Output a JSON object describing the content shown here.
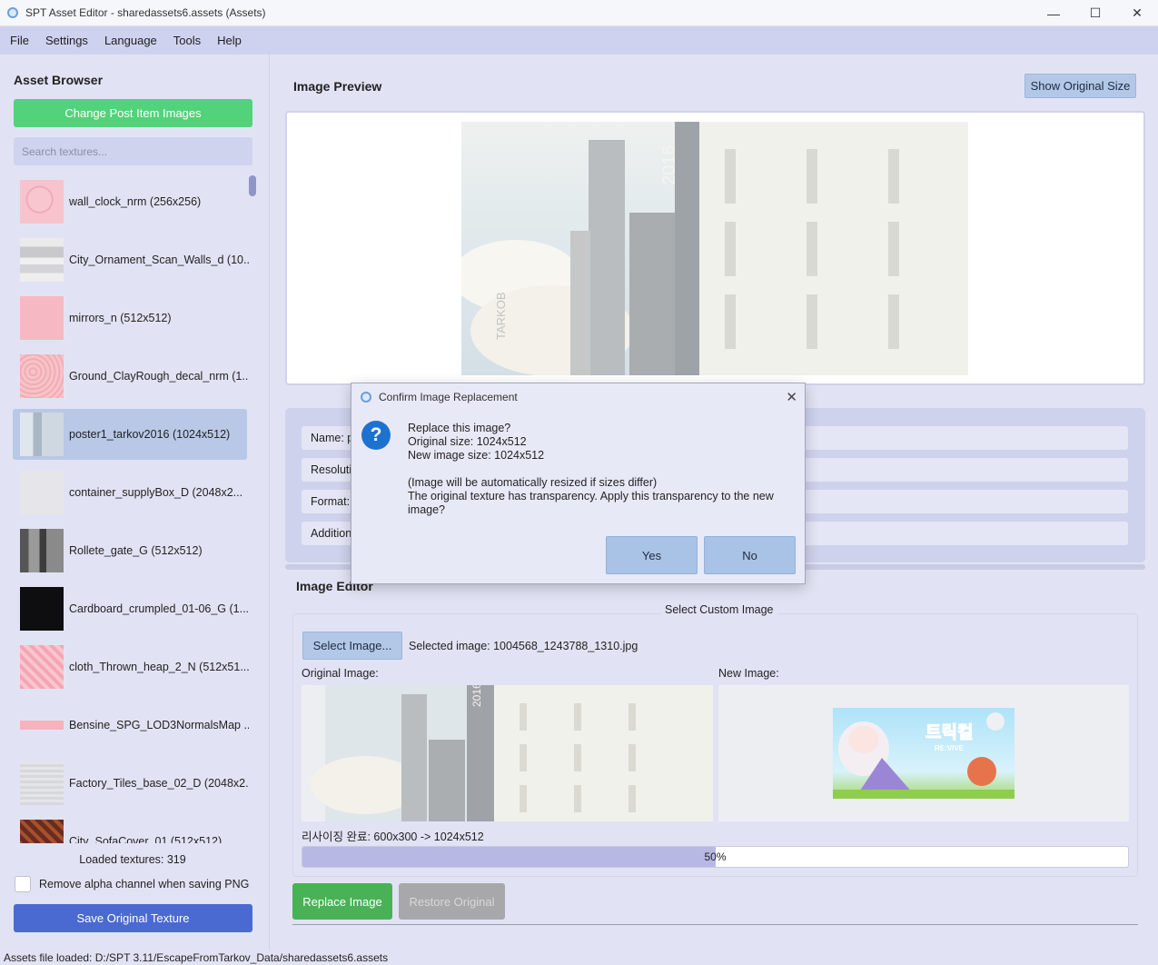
{
  "window": {
    "title": "SPT Asset Editor - sharedassets6.assets (Assets)",
    "minimize": "—",
    "maximize": "☐",
    "close": "✕"
  },
  "menu": [
    "File",
    "Settings",
    "Language",
    "Tools",
    "Help"
  ],
  "sidebar": {
    "heading": "Asset Browser",
    "change_button": "Change Post Item Images",
    "search_placeholder": "Search textures...",
    "items": [
      {
        "label": "wall_clock_nrm (256x256)",
        "thumb": "pink-normal",
        "selected": false
      },
      {
        "label": "City_Ornament_Scan_Walls_d (10...",
        "thumb": "gray-stripes",
        "selected": false
      },
      {
        "label": "mirrors_n (512x512)",
        "thumb": "pink-flat",
        "selected": false
      },
      {
        "label": "Ground_ClayRough_decal_nrm (1...",
        "thumb": "pink-rough",
        "selected": false
      },
      {
        "label": "poster1_tarkov2016 (1024x512)",
        "thumb": "poster",
        "selected": true
      },
      {
        "label": "container_supplyBox_D (2048x2...",
        "thumb": "light-gray",
        "selected": false
      },
      {
        "label": "Rollete_gate_G (512x512)",
        "thumb": "dark-gray",
        "selected": false
      },
      {
        "label": "Cardboard_crumpled_01-06_G (1...",
        "thumb": "black",
        "selected": false
      },
      {
        "label": "cloth_Thrown_heap_2_N (512x51...",
        "thumb": "pink-cloth",
        "selected": false
      },
      {
        "label": "Bensine_SPG_LOD3NormalsMap ...",
        "thumb": "pink-strip",
        "selected": false
      },
      {
        "label": "Factory_Tiles_base_02_D (2048x2...",
        "thumb": "tiles",
        "selected": false
      },
      {
        "label": "City_SofaCover_01 (512x512)",
        "thumb": "sofa",
        "selected": false
      }
    ],
    "loaded_text": "Loaded textures: 319",
    "remove_alpha_label": "Remove alpha channel when saving PNG",
    "remove_alpha_checked": false,
    "save_button": "Save Original Texture"
  },
  "main": {
    "preview_title": "Image Preview",
    "show_original_button": "Show Original Size",
    "poster_year": "2016",
    "poster_brand": "TARKOB",
    "info_rows": [
      "Name: p",
      "Resolutio",
      "Format: ",
      "Addition"
    ],
    "editor_title": "Image Editor",
    "group_title": "Select Custom Image",
    "select_button": "Select Image...",
    "selected_image_text": "Selected image: 1004568_1243788_1310.jpg",
    "original_label": "Original Image:",
    "new_label": "New Image:",
    "new_image_title": "트릭컬",
    "new_image_subtitle": "RE:VIVE",
    "resize_status": "리사이징 완료: 600x300 -> 1024x512",
    "progress_percent": 50,
    "progress_text": "50%",
    "replace_button": "Replace Image",
    "restore_button": "Restore Original"
  },
  "status": "Assets file loaded: D:/SPT 3.11/EscapeFromTarkov_Data/sharedassets6.assets",
  "dialog": {
    "title": "Confirm Image Replacement",
    "close": "✕",
    "icon": "question-icon",
    "icon_glyph": "?",
    "lines": [
      "Replace this image?",
      "Original size: 1024x512",
      "New image size: 1024x512",
      "",
      "(Image will be automatically resized if sizes differ)",
      "The original texture has transparency. Apply this transparency to the new",
      "image?"
    ],
    "yes": "Yes",
    "no": "No"
  },
  "colors": {
    "accent_green": "#52d27a",
    "save_blue": "#4a6ad2",
    "replace_green": "#49b256",
    "dialog_question": "#1e72cf"
  }
}
